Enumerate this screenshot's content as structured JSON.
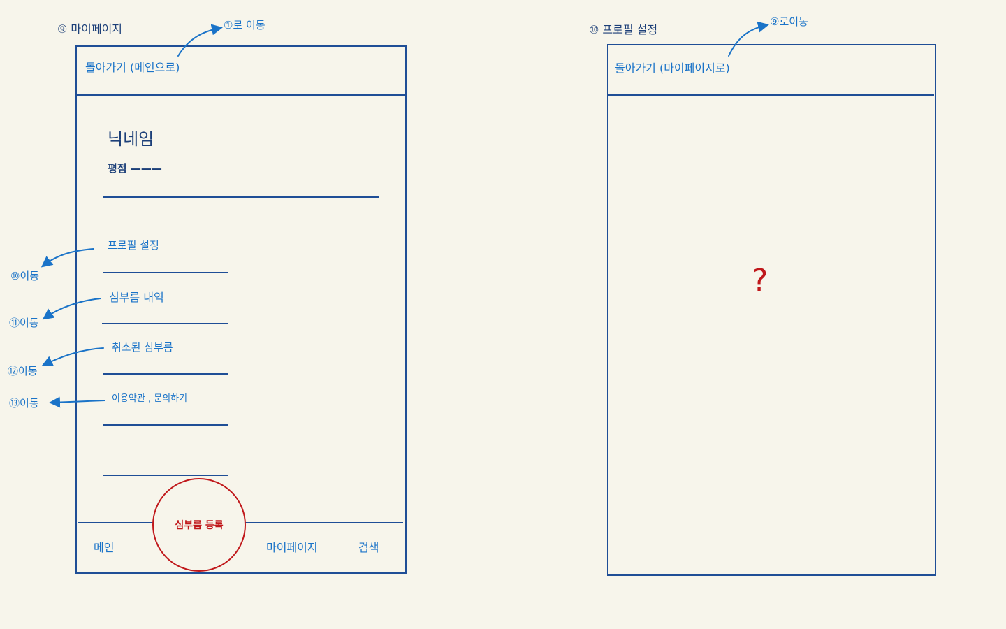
{
  "screen_9": {
    "title": "⑨ 마이페이지",
    "header": {
      "back_label": "돌아가기 (메인으로)",
      "annotation": "①로 이동"
    },
    "profile": {
      "nickname": "닉네임",
      "rating_label": "평점 ———"
    },
    "menu": [
      {
        "label": "프로필 설정",
        "annotation": "⑩이동"
      },
      {
        "label": "심부름 내역",
        "annotation": "⑪이동"
      },
      {
        "label": "취소된 심부름",
        "annotation": "⑫이동"
      },
      {
        "label": "이용약관 , 문의하기",
        "annotation": "⑬이동"
      }
    ],
    "bottom_nav": {
      "main": "메인",
      "register": "심부름 등록",
      "mypage": "마이페이지",
      "search": "검색"
    }
  },
  "screen_10": {
    "title": "⑩ 프로필 설정",
    "header": {
      "back_label": "돌아가기 (마이페이지로)",
      "annotation": "⑨로이동"
    },
    "placeholder": "?"
  },
  "colors": {
    "background": "#f7f5eb",
    "frame": "#1f4e96",
    "annotation_blue": "#1a73c8",
    "accent_red": "#c0181b"
  }
}
